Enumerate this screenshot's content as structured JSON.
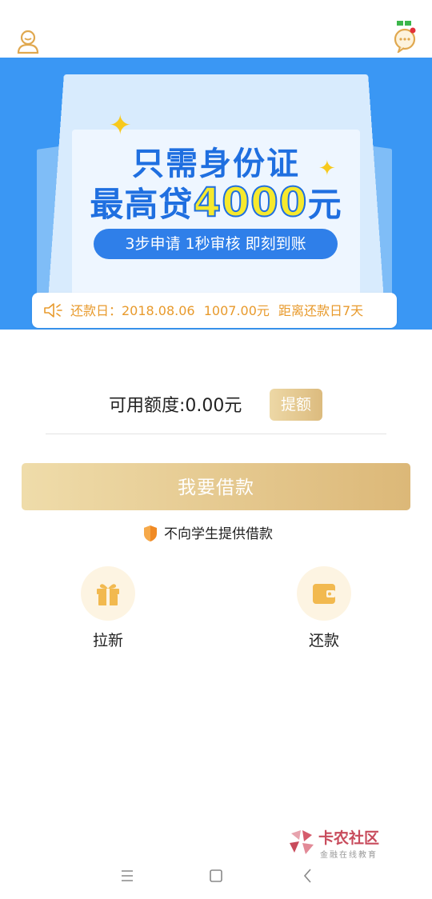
{
  "header": {
    "profile_icon": "user-icon",
    "message_icon": "chat-bubble-icon"
  },
  "banner": {
    "headline_line1": "只需身份证",
    "headline_line2_prefix": "最高贷",
    "headline_amount": "4000",
    "headline_line2_suffix": "元",
    "pill_text": "3步申请  1秒审核  即刻到账",
    "colors": {
      "background": "#3a97f4",
      "headline": "#1f6fe0",
      "amount": "#f6e92d"
    }
  },
  "notice": {
    "icon": "speaker-icon",
    "label": "还款日：2018.08.06",
    "amount": "1007.00元",
    "countdown": "距离还款日7天"
  },
  "credit": {
    "text": "可用额度:0.00元",
    "raise_button": "提额"
  },
  "borrow_button": "我要借款",
  "student_notice": "不向学生提供借款",
  "features": [
    {
      "label": "拉新",
      "icon": "gift-icon"
    },
    {
      "label": "还款",
      "icon": "wallet-icon"
    }
  ],
  "watermark": {
    "title": "卡农社区",
    "subtitle": "金融在线教育"
  },
  "navbar": {
    "menu_icon": "menu-icon",
    "home_icon": "home-square-icon",
    "back_icon": "back-chevron-icon"
  },
  "accent_color": "#e89a2c"
}
